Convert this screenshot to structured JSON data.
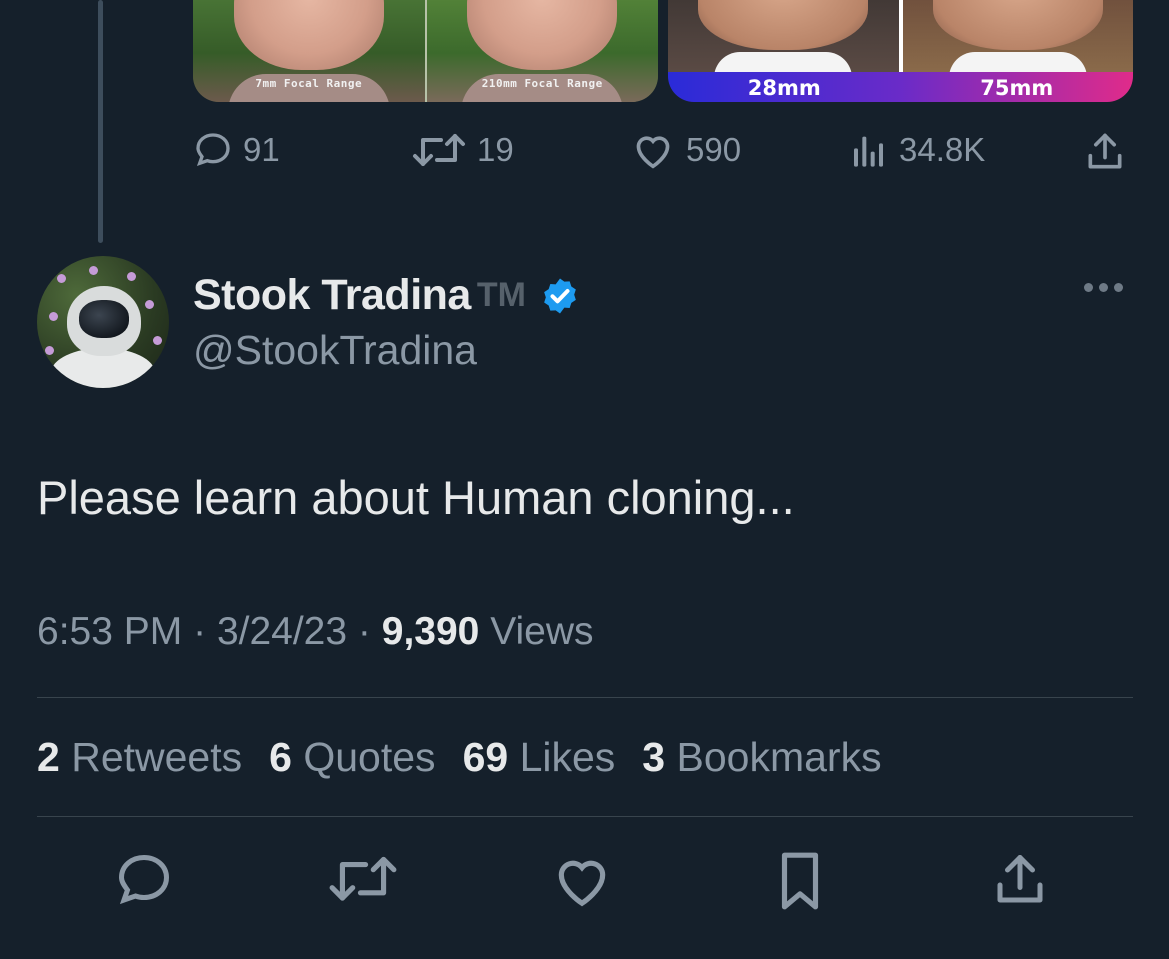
{
  "media": {
    "left_captions": [
      "7mm Focal Range",
      "210mm Focal Range"
    ],
    "right_labels": [
      "28mm",
      "75mm"
    ]
  },
  "prev_tweet_actions": {
    "replies": "91",
    "retweets": "19",
    "likes": "590",
    "views": "34.8K"
  },
  "tweet": {
    "display_name": "Stook Tradina",
    "name_suffix": "TM",
    "handle": "@StookTradina",
    "text": "Please learn about Human cloning...",
    "time": "6:53 PM",
    "date": "3/24/23",
    "views_count": "9,390",
    "views_label": "Views"
  },
  "stats": {
    "retweets_count": "2",
    "retweets_label": "Retweets",
    "quotes_count": "6",
    "quotes_label": "Quotes",
    "likes_count": "69",
    "likes_label": "Likes",
    "bookmarks_count": "3",
    "bookmarks_label": "Bookmarks"
  },
  "colors": {
    "background": "#15202b",
    "text_primary": "#e7e9ea",
    "text_secondary": "#8b98a5",
    "verified": "#1d9bf0",
    "divider": "#38444d"
  },
  "icons": [
    "reply-icon",
    "retweet-icon",
    "like-icon",
    "views-icon",
    "share-icon",
    "verified-badge-icon",
    "more-icon",
    "bookmark-icon"
  ]
}
